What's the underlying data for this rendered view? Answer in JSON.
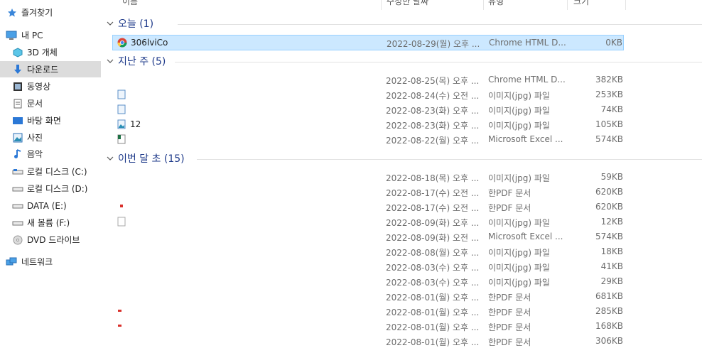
{
  "sidebar": {
    "quick_access": "즐겨찾기",
    "this_pc": "내 PC",
    "items": [
      {
        "label": "3D 개체",
        "icon": "3d-objects-icon"
      },
      {
        "label": "다운로드",
        "icon": "download-arrow-icon",
        "selected": true
      },
      {
        "label": "동영상",
        "icon": "video-icon"
      },
      {
        "label": "문서",
        "icon": "document-icon"
      },
      {
        "label": "바탕 화면",
        "icon": "desktop-icon"
      },
      {
        "label": "사진",
        "icon": "pictures-icon"
      },
      {
        "label": "음악",
        "icon": "music-icon"
      },
      {
        "label": "로컬 디스크 (C:)",
        "icon": "drive-icon"
      },
      {
        "label": "로컬 디스크 (D:)",
        "icon": "drive-icon"
      },
      {
        "label": "DATA (E:)",
        "icon": "drive-icon"
      },
      {
        "label": "새 볼륨 (F:)",
        "icon": "drive-icon"
      },
      {
        "label": "DVD 드라이브",
        "icon": "dvd-icon"
      }
    ],
    "network": "네트워크"
  },
  "header": {
    "name": "이름",
    "date": "수정한 날짜",
    "type": "유형",
    "size": "크기"
  },
  "groups": {
    "today": "오늘 (1)",
    "last_week": "지난 주 (5)",
    "this_month": "이번 달 초 (15)"
  },
  "today_rows": [
    {
      "name": "306lviCo",
      "date": "2022-08-29(월) 오후 ...",
      "type": "Chrome HTML D...",
      "size": "0KB"
    }
  ],
  "last_week_rows": [
    {
      "name": "",
      "date": "2022-08-25(목) 오후 ...",
      "type": "Chrome HTML D...",
      "size": "382KB"
    },
    {
      "name": "",
      "date": "2022-08-24(수) 오전 ...",
      "type": "이미지(jpg) 파일",
      "size": "253KB"
    },
    {
      "name": "",
      "date": "2022-08-23(화) 오후 ...",
      "type": "이미지(jpg) 파일",
      "size": "74KB"
    },
    {
      "name": "12",
      "date": "2022-08-23(화) 오후 ...",
      "type": "이미지(jpg) 파일",
      "size": "105KB"
    },
    {
      "name": "",
      "date": "2022-08-22(월) 오후 ...",
      "type": "Microsoft Excel ...",
      "size": "574KB"
    }
  ],
  "this_month_rows": [
    {
      "name": "",
      "date": "2022-08-18(목) 오후 ...",
      "type": "이미지(jpg) 파일",
      "size": "59KB"
    },
    {
      "name": "",
      "date": "2022-08-17(수) 오전 ...",
      "type": "한PDF 문서",
      "size": "620KB"
    },
    {
      "name": "",
      "date": "2022-08-17(수) 오전 ...",
      "type": "한PDF 문서",
      "size": "620KB"
    },
    {
      "name": "",
      "date": "2022-08-09(화) 오후 ...",
      "type": "이미지(jpg) 파일",
      "size": "12KB"
    },
    {
      "name": "",
      "date": "2022-08-09(화) 오전 ...",
      "type": "Microsoft Excel ...",
      "size": "574KB"
    },
    {
      "name": "",
      "date": "2022-08-08(월) 오후 ...",
      "type": "이미지(jpg) 파일",
      "size": "18KB"
    },
    {
      "name": "",
      "date": "2022-08-03(수) 오후 ...",
      "type": "이미지(jpg) 파일",
      "size": "41KB"
    },
    {
      "name": "",
      "date": "2022-08-03(수) 오후 ...",
      "type": "이미지(jpg) 파일",
      "size": "29KB"
    },
    {
      "name": "",
      "date": "2022-08-01(월) 오후 ...",
      "type": "한PDF 문서",
      "size": "681KB"
    },
    {
      "name": "",
      "date": "2022-08-01(월) 오후 ...",
      "type": "한PDF 문서",
      "size": "285KB"
    },
    {
      "name": "",
      "date": "2022-08-01(월) 오후 ...",
      "type": "한PDF 문서",
      "size": "168KB"
    },
    {
      "name": "",
      "date": "2022-08-01(월) 오후 ...",
      "type": "한PDF 문서",
      "size": "306KB"
    }
  ],
  "colors": {
    "selection_bg": "#cce8ff",
    "selection_border": "#99d1ff",
    "group_label": "#1e3a8a",
    "nav_selected": "#dcdcdc",
    "accent_blue": "#2b78d6"
  }
}
